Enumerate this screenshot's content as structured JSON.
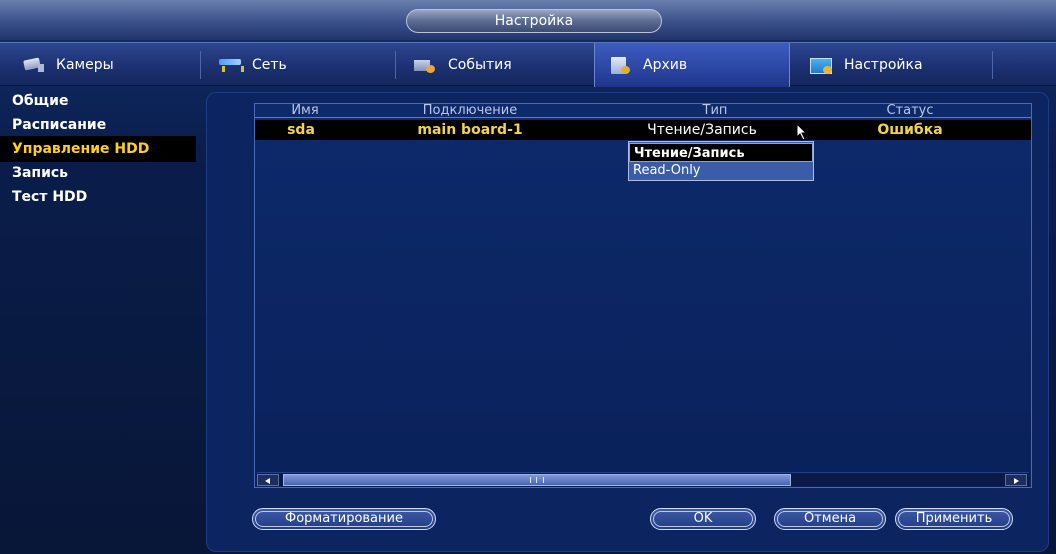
{
  "window": {
    "title": "Настройка"
  },
  "tabs": [
    {
      "label": "Камеры",
      "icon": "camera-icon"
    },
    {
      "label": "Сеть",
      "icon": "network-icon"
    },
    {
      "label": "События",
      "icon": "events-icon"
    },
    {
      "label": "Архив",
      "icon": "archive-icon",
      "active": true
    },
    {
      "label": "Настройка",
      "icon": "settings-icon"
    }
  ],
  "sidebar": {
    "items": [
      {
        "label": "Общие"
      },
      {
        "label": "Расписание"
      },
      {
        "label": "Управление HDD",
        "active": true
      },
      {
        "label": "Запись"
      },
      {
        "label": "Тест HDD"
      }
    ]
  },
  "table": {
    "columns": [
      "Имя",
      "Подключение",
      "Тип",
      "Статус"
    ],
    "rows": [
      {
        "name": "sda",
        "connection": "main board-1",
        "type": "Чтение/Запись",
        "status": "Ошибка"
      }
    ]
  },
  "type_dropdown": {
    "options": [
      "Чтение/Запись",
      "Read-Only"
    ],
    "selected": "Чтение/Запись"
  },
  "buttons": {
    "format": "Форматирование",
    "ok": "OK",
    "cancel": "Отмена",
    "apply": "Применить"
  },
  "colors": {
    "accent_yellow": "#ffcf1f",
    "panel_blue": "#0c2560",
    "selection_black": "#000000"
  }
}
